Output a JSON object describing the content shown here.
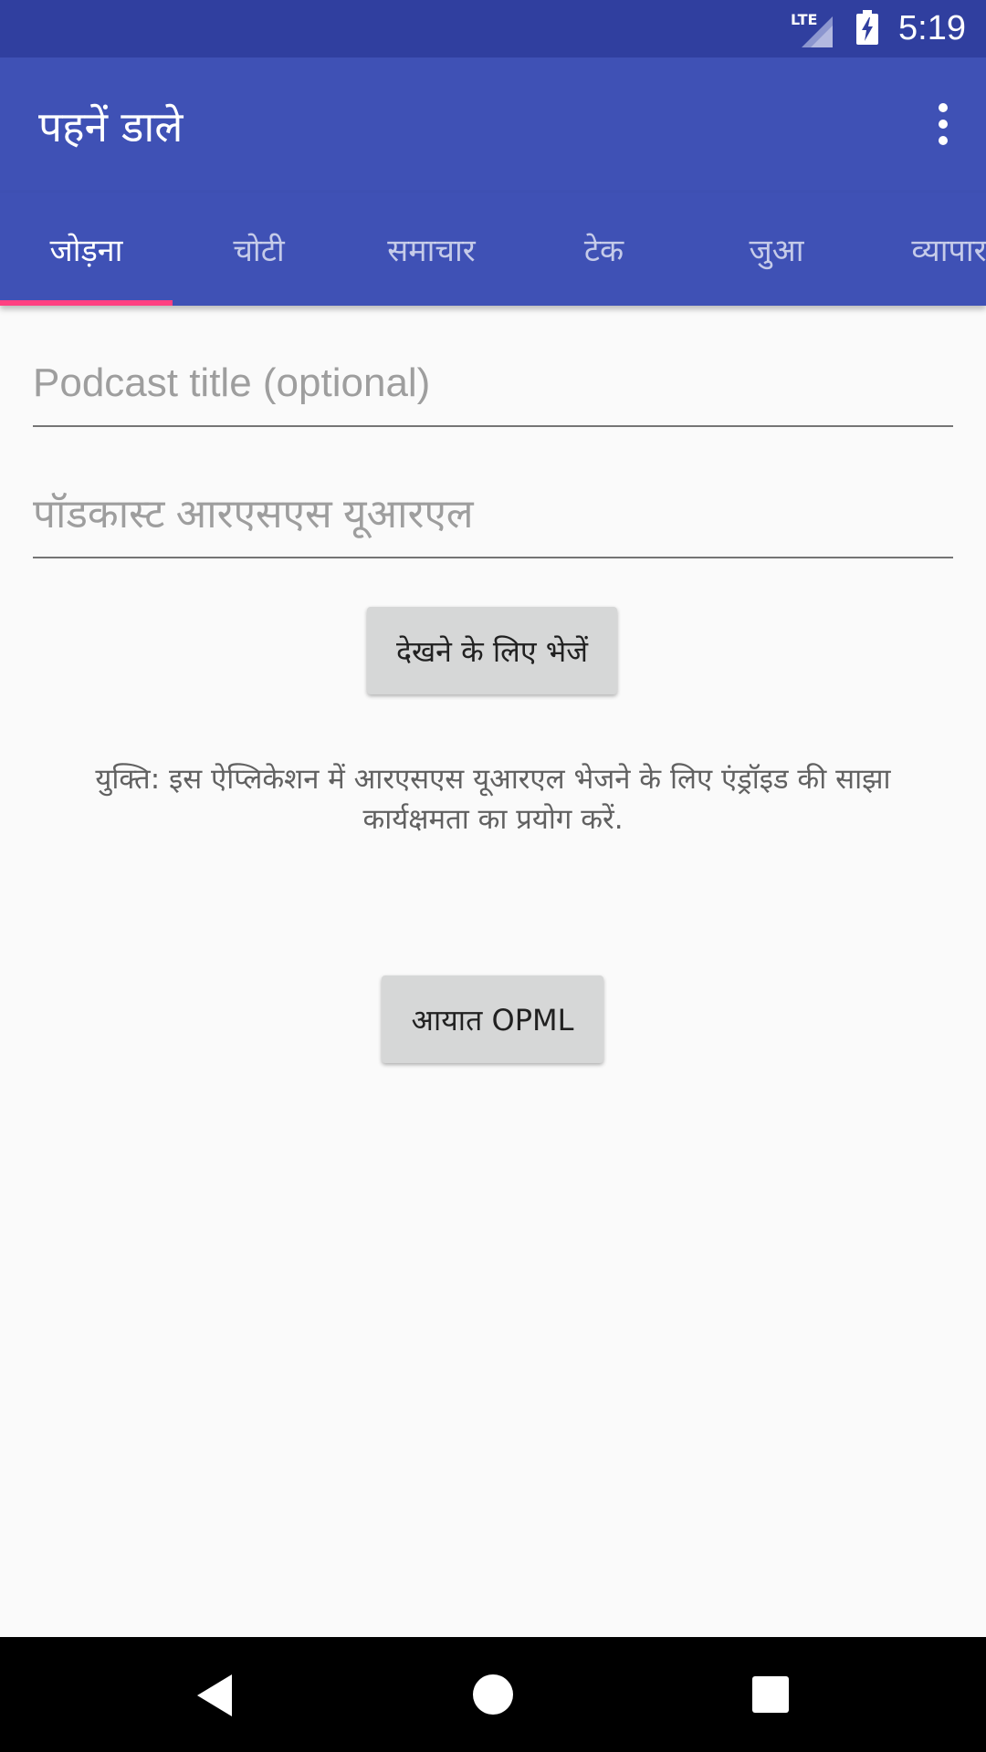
{
  "status_bar": {
    "network": "LTE",
    "time": "5:19",
    "icons": [
      "lte-signal-icon",
      "battery-charging-icon"
    ]
  },
  "toolbar": {
    "title": "पहनें डाले",
    "menu_icon": "overflow-menu-icon"
  },
  "tabs": [
    {
      "label": "जोड़ना",
      "active": true
    },
    {
      "label": "चोटी",
      "active": false
    },
    {
      "label": "समाचार",
      "active": false
    },
    {
      "label": "टेक",
      "active": false
    },
    {
      "label": "जुआ",
      "active": false
    },
    {
      "label": "व्यापार",
      "active": false
    }
  ],
  "form": {
    "title_field": {
      "value": "",
      "placeholder": "Podcast title (optional)"
    },
    "url_field": {
      "value": "",
      "placeholder": "पॉडकास्ट आरएसएस यूआरएल"
    },
    "submit_label": "देखने के लिए भेजें",
    "hint": "युक्ति: इस ऐप्लिकेशन में आरएसएस यूआरएल भेजने के लिए एंड्रॉइड की साझा कार्यक्षमता का प्रयोग करें.",
    "import_label": "आयात OPML"
  },
  "navbar": {
    "icons": [
      "back-icon",
      "home-icon",
      "recents-icon"
    ]
  },
  "colors": {
    "status_bar": "#303f9f",
    "primary": "#3f51b5",
    "accent": "#ff4081",
    "background": "#fafafa",
    "button": "#d6d7d7"
  }
}
